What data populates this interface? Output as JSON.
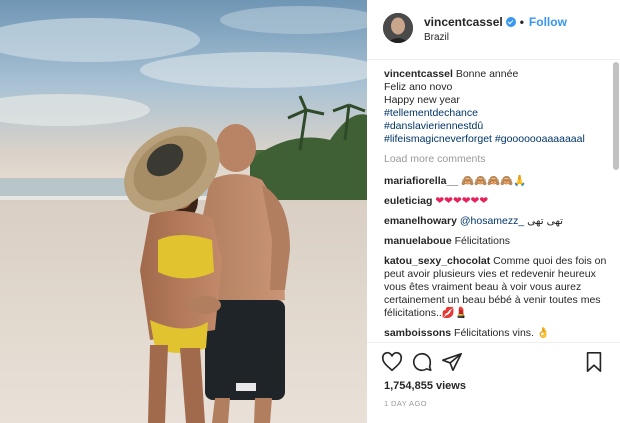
{
  "header": {
    "username": "vincentcassel",
    "follow_label": "Follow",
    "location": "Brazil",
    "separator": "•"
  },
  "caption": {
    "username": "vincentcassel",
    "lines": [
      "Bonne année",
      "Feliz ano novo",
      "Happy new year",
      "#tellementdechance",
      "#danslavieriennestdû",
      "#lifeismagicneverforget",
      "#gooooooaaaaaaal"
    ]
  },
  "load_more_label": "Load more comments",
  "comments": [
    {
      "username": "mariafiorella__",
      "text": "🙈🙈🙈🙈🙏"
    },
    {
      "username": "euleticiag",
      "text": "❤❤❤❤❤❤"
    },
    {
      "username": "emanelhowary",
      "mention": "@hosamezz_",
      "text": "تهى تهى"
    },
    {
      "username": "manuelaboue",
      "text": "Félicitations"
    },
    {
      "username": "katou_sexy_chocolat",
      "text": "Comme quoi des fois on peut avoir plusieurs vies et redevenir heureux vous êtes vraiment beau à voir vous aurez certainement un beau bébé à venir toutes mes félicitations..💋💄"
    },
    {
      "username": "samboissons",
      "text": "Félicitations vins. 👌"
    }
  ],
  "stats": {
    "views": "1,754,855 views",
    "time_ago": "1 DAY AGO"
  },
  "icons": {
    "like": "heart-outline-icon",
    "comment": "speech-bubble-icon",
    "share": "paper-plane-icon",
    "save": "bookmark-icon"
  },
  "colors": {
    "link": "#3897f0",
    "hashtag": "#003569",
    "muted": "#999999",
    "text": "#262626"
  }
}
